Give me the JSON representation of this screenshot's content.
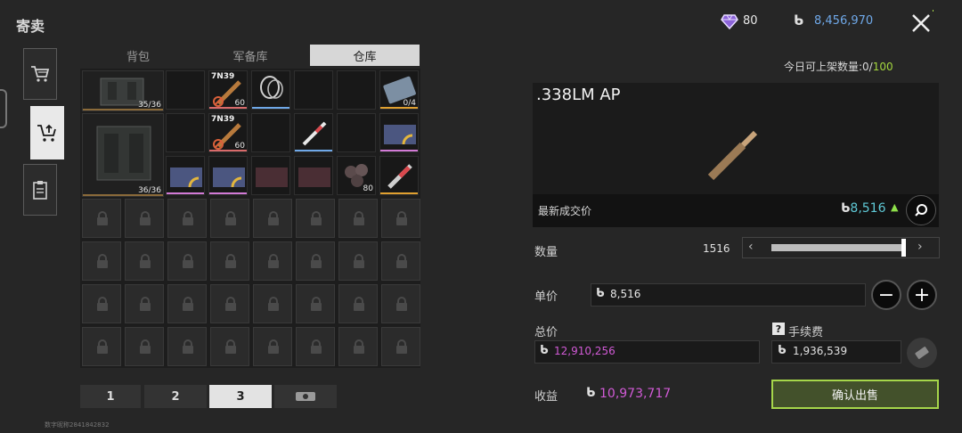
{
  "header": {
    "title": "寄卖",
    "gems": "80",
    "balance": "8,456,970",
    "coin_symbol": "ₐ"
  },
  "tabs": [
    {
      "label": "背包"
    },
    {
      "label": "军备库"
    },
    {
      "label": "仓库"
    }
  ],
  "grid": {
    "bag_large_1_count": "35/36",
    "bag_large_2_count": "36/36",
    "ammo_1_label": "7N39",
    "ammo_1_qty": "60",
    "ammo_2_label": "7N39",
    "ammo_2_qty": "60",
    "case_qty": "0/4",
    "loot_qty": "80"
  },
  "pagination": {
    "p1": "1",
    "p2": "2",
    "p3": "3"
  },
  "watermark": "数字昵称2841842832",
  "sell": {
    "daily_prefix": "今日可上架数量:0/",
    "daily_max": "100",
    "item_name": ".338LM AP",
    "last_price_label": "最新成交价",
    "last_price": "8,516",
    "quantity_label": "数量",
    "quantity_value": "1516",
    "slider_fraction": 0.96,
    "unit_label": "单价",
    "unit_value": "8,516",
    "total_label": "总价",
    "total_value": "12,910,256",
    "fee_label": "手续费",
    "fee_value": "1,936,539",
    "profit_label": "收益",
    "profit_value": "10,973,717",
    "confirm_label": "确认出售"
  },
  "colors": {
    "accent_green": "#a6d64a",
    "price_teal": "#5fc9d6",
    "total_magenta": "#d15ad6",
    "balance_blue": "#6fa8e8"
  }
}
